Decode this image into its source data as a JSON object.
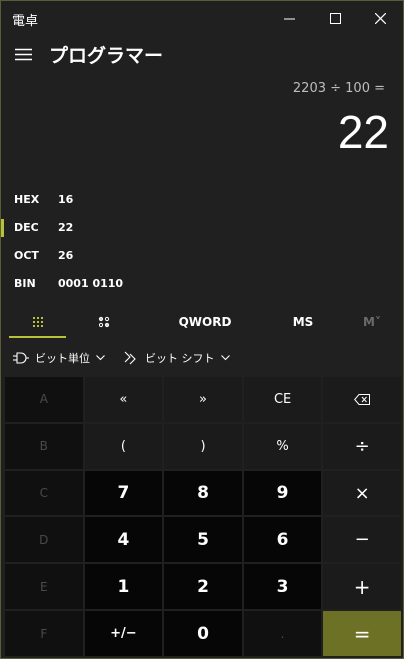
{
  "window": {
    "app_title": "電卓",
    "minimize_label": "—",
    "maximize_label": "☐",
    "close_label": "✕"
  },
  "header": {
    "mode_title": "プログラマー"
  },
  "display": {
    "expression": "2203 ÷ 100 =",
    "result": "22"
  },
  "radix": [
    {
      "label": "HEX",
      "value": "16",
      "active": false
    },
    {
      "label": "DEC",
      "value": "22",
      "active": true
    },
    {
      "label": "OCT",
      "value": "26",
      "active": false
    },
    {
      "label": "BIN",
      "value": "0001 0110",
      "active": false
    }
  ],
  "tabs": {
    "word_size": "QWORD",
    "ms": "MS",
    "mplus": "M˅"
  },
  "bitops": {
    "bitwise_label": "ビット単位",
    "bitshift_label": "ビット シフト"
  },
  "keys": {
    "r1": [
      "A",
      "«",
      "»",
      "CE",
      "⌫"
    ],
    "r2": [
      "B",
      "(",
      ")",
      "%",
      "÷"
    ],
    "r3": [
      "C",
      "7",
      "8",
      "9",
      "×"
    ],
    "r4": [
      "D",
      "4",
      "5",
      "6",
      "−"
    ],
    "r5": [
      "E",
      "1",
      "2",
      "3",
      "+"
    ],
    "r6": [
      "F",
      "+/−",
      "0",
      ".",
      "="
    ]
  },
  "colors": {
    "accent": "#b8c13a",
    "equals_bg": "#6d7126",
    "background": "#202020"
  }
}
